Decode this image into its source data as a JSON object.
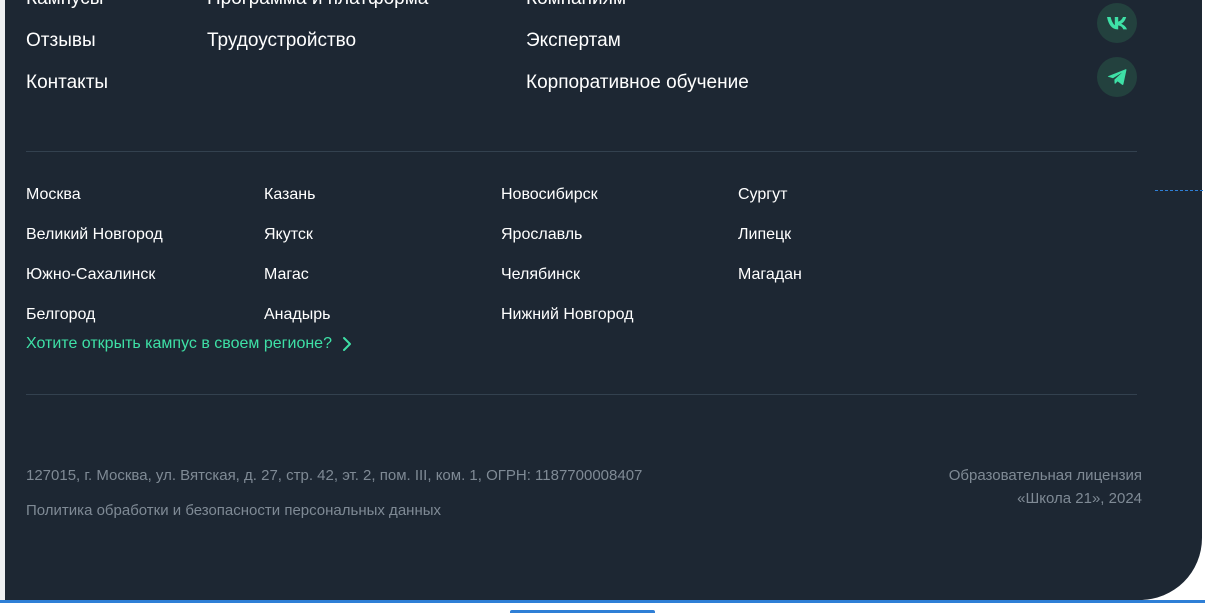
{
  "nav": {
    "col1": [
      "Кампусы",
      "Отзывы",
      "Контакты"
    ],
    "col2": [
      "Программа и платформа",
      "Трудоустройство"
    ],
    "col3": [
      "Компаниям",
      "Экспертам",
      "Корпоративное обучение"
    ]
  },
  "social": [
    {
      "icon": "vk-icon"
    },
    {
      "icon": "telegram-icon"
    }
  ],
  "cities": [
    [
      "Москва",
      "Казань",
      "Новосибирск",
      "Сургут"
    ],
    [
      "Великий Новгород",
      "Якутск",
      "Ярославль",
      "Липецк"
    ],
    [
      "Южно-Сахалинск",
      "Магас",
      "Челябинск",
      "Магадан"
    ],
    [
      "Белгород",
      "Анадырь",
      "Нижний Новгород"
    ]
  ],
  "campus_cta": "Хотите открыть кампус в своем регионе?",
  "legal": {
    "address": "127015, г. Москва, ул. Вятская, д. 27, стр. 42, эт. 2, пом. III, ком. 1, ОГРН: 1187700008407",
    "privacy": "Политика обработки и безопасности персональных данных",
    "license_line1": "Образовательная лицензия",
    "license_line2": "«Школа 21», 2024"
  },
  "colors": {
    "background": "#1d2733",
    "accent": "#3ee0a6",
    "muted_text": "#7f8a95",
    "divider": "#33414f"
  }
}
